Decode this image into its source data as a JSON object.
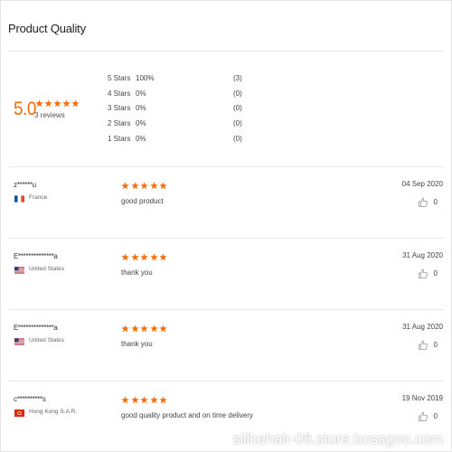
{
  "section_title": "Product Quality",
  "summary": {
    "score": "5.0",
    "rating": 5,
    "reviews_text": "3 reviews",
    "breakdown": [
      {
        "label": "5 Stars",
        "percent": "100%",
        "count": "(3)"
      },
      {
        "label": "4 Stars",
        "percent": "0%",
        "count": "(0)"
      },
      {
        "label": "3 Stars",
        "percent": "0%",
        "count": "(0)"
      },
      {
        "label": "2 Stars",
        "percent": "0%",
        "count": "(0)"
      },
      {
        "label": "1 Stars",
        "percent": "0%",
        "count": "(0)"
      }
    ]
  },
  "reviews": [
    {
      "reviewer": "z******u",
      "country": "France",
      "flag": "flag-france-icon",
      "rating": 5,
      "comment": "good product",
      "date": "04 Sep 2020",
      "likes": "0"
    },
    {
      "reviewer": "E**************a",
      "country": "United States",
      "flag": "flag-us-icon",
      "rating": 5,
      "comment": "thank you",
      "date": "31 Aug 2020",
      "likes": "0"
    },
    {
      "reviewer": "E**************a",
      "country": "United States",
      "flag": "flag-us-icon",
      "rating": 5,
      "comment": "thank you",
      "date": "31 Aug 2020",
      "likes": "0"
    },
    {
      "reviewer": "c**********s",
      "country": "Hong Kong S.A.R.",
      "flag": "flag-hong-kong-icon",
      "rating": 5,
      "comment": "good quality product and on time delivery",
      "date": "19 Nov 2019",
      "likes": "0"
    }
  ],
  "watermark": "silikehair-06.store.bossgoo.com",
  "colors": {
    "accent": "#ff6a00",
    "text": "#333333",
    "divider": "#e8e8e8"
  }
}
